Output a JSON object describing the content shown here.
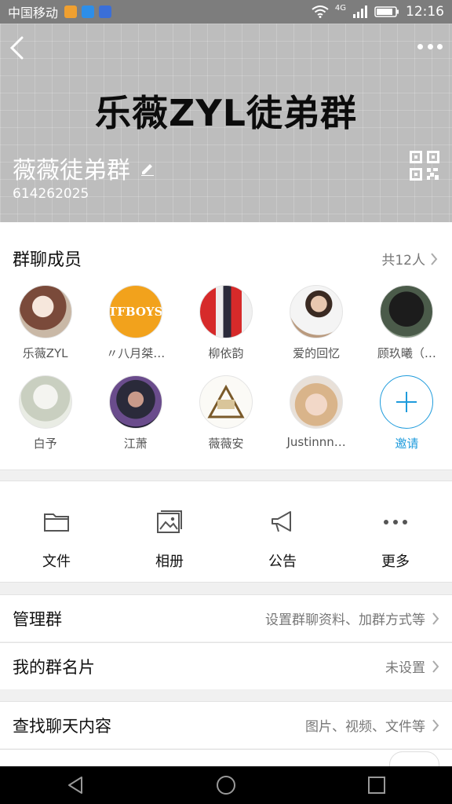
{
  "status_bar": {
    "carrier": "中国移动",
    "network": "4G",
    "time": "12:16"
  },
  "header": {
    "banner_text": "乐薇ZYL徒弟群",
    "group_name": "薇薇徒弟群",
    "group_id": "614262025"
  },
  "members": {
    "title": "群聊成员",
    "count_label": "共12人",
    "items": [
      {
        "name": "乐薇ZYL"
      },
      {
        "name": "〃八月桀…"
      },
      {
        "name": "柳依韵"
      },
      {
        "name": "爱的回忆"
      },
      {
        "name": "顾玖曦（…"
      },
      {
        "name": "白予"
      },
      {
        "name": "江萧"
      },
      {
        "name": "薇薇安"
      },
      {
        "name": "Justinnn…"
      }
    ],
    "invite_label": "邀请"
  },
  "shortcuts": [
    {
      "label": "文件",
      "icon": "folder-icon"
    },
    {
      "label": "相册",
      "icon": "album-icon"
    },
    {
      "label": "公告",
      "icon": "megaphone-icon"
    },
    {
      "label": "更多",
      "icon": "more-dots-icon"
    }
  ],
  "rows": {
    "manage": {
      "label": "管理群",
      "value": "设置群聊资料、加群方式等"
    },
    "card": {
      "label": "我的群名片",
      "value": "未设置"
    },
    "search": {
      "label": "查找聊天内容",
      "value": "图片、视频、文件等"
    }
  },
  "colors": {
    "accent": "#1e9bdc",
    "header_bg": "#bdbdbd"
  }
}
